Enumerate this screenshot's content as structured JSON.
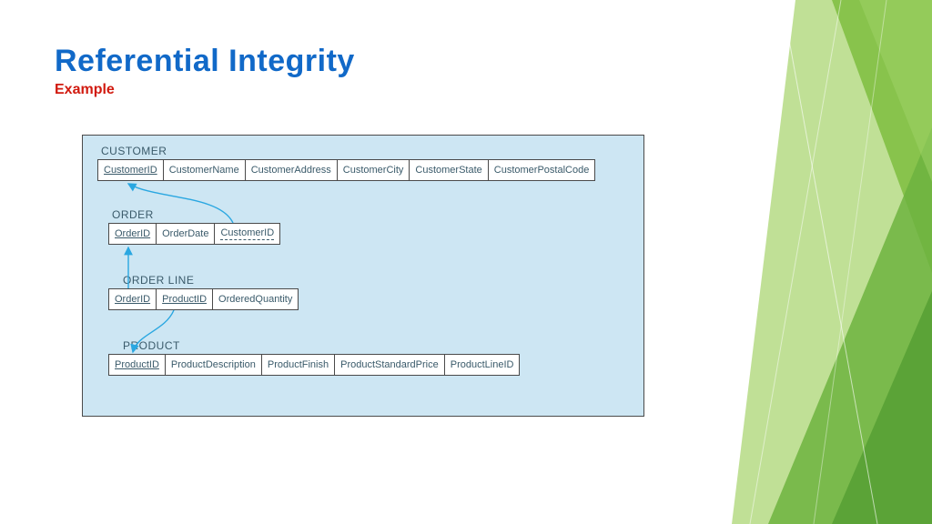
{
  "title": "Referential Integrity",
  "subtitle": "Example",
  "tables": {
    "customer": {
      "name": "CUSTOMER",
      "cols": [
        "CustomerID",
        "CustomerName",
        "CustomerAddress",
        "CustomerCity",
        "CustomerState",
        "CustomerPostalCode"
      ]
    },
    "order": {
      "name": "ORDER",
      "cols": [
        "OrderID",
        "OrderDate",
        "CustomerID"
      ]
    },
    "orderline": {
      "name": "ORDER LINE",
      "cols": [
        "OrderID",
        "ProductID",
        "OrderedQuantity"
      ]
    },
    "product": {
      "name": "PRODUCT",
      "cols": [
        "ProductID",
        "ProductDescription",
        "ProductFinish",
        "ProductStandardPrice",
        "ProductLineID"
      ]
    }
  }
}
